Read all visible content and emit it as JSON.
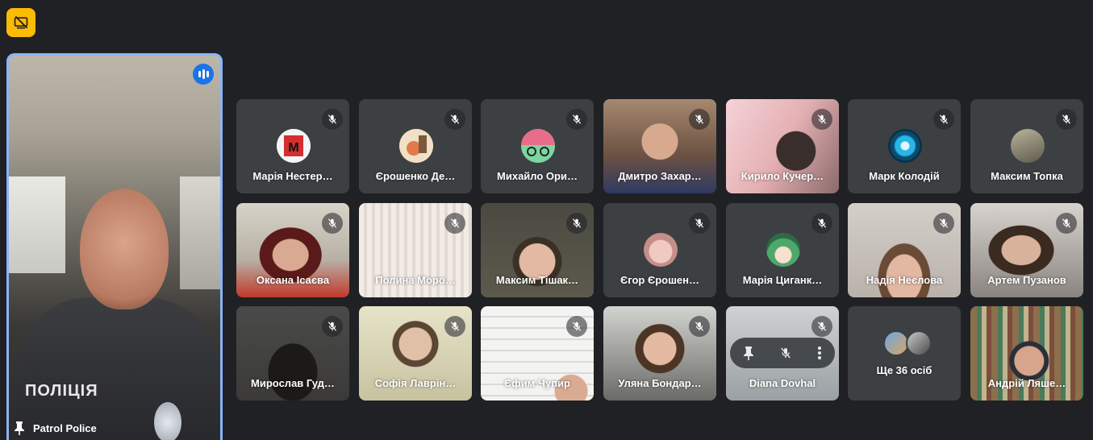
{
  "toolbar": {
    "present_off_icon": "screen-share-off-icon",
    "accent": "#fbbc04"
  },
  "main": {
    "name": "Patrol Police",
    "patch": "ПОЛІЦІЯ",
    "border": "#8ab4f8"
  },
  "tiles": [
    {
      "name": "Марія Нестер…",
      "kind": "avatar"
    },
    {
      "name": "Єрошенко Де…",
      "kind": "avatar"
    },
    {
      "name": "Михайло Ори…",
      "kind": "avatar"
    },
    {
      "name": "Дмитро Захар…",
      "kind": "video"
    },
    {
      "name": "Кирило Кучер…",
      "kind": "video"
    },
    {
      "name": "Марк Колодій",
      "kind": "avatar"
    },
    {
      "name": "Максим Топка",
      "kind": "avatar"
    },
    {
      "name": "Оксана Ісаєва",
      "kind": "video"
    },
    {
      "name": "Полина Моро…",
      "kind": "video"
    },
    {
      "name": "Максим Тішак…",
      "kind": "video"
    },
    {
      "name": "Єгор Єрошен…",
      "kind": "avatar"
    },
    {
      "name": "Марія Циганк…",
      "kind": "avatar"
    },
    {
      "name": "Надія Неєлова",
      "kind": "video"
    },
    {
      "name": "Артем Пузанов",
      "kind": "video"
    },
    {
      "name": "Мирослав Гуд…",
      "kind": "video"
    },
    {
      "name": "Софія Лаврін…",
      "kind": "video"
    },
    {
      "name": "Єфим Чупир",
      "kind": "video"
    },
    {
      "name": "Уляна Бондар…",
      "kind": "video"
    },
    {
      "name": "Diana Dovhal",
      "kind": "video"
    },
    {
      "name": "Ще 36 осіб",
      "kind": "more"
    },
    {
      "name": "Андрій Ляше…",
      "kind": "video"
    }
  ]
}
